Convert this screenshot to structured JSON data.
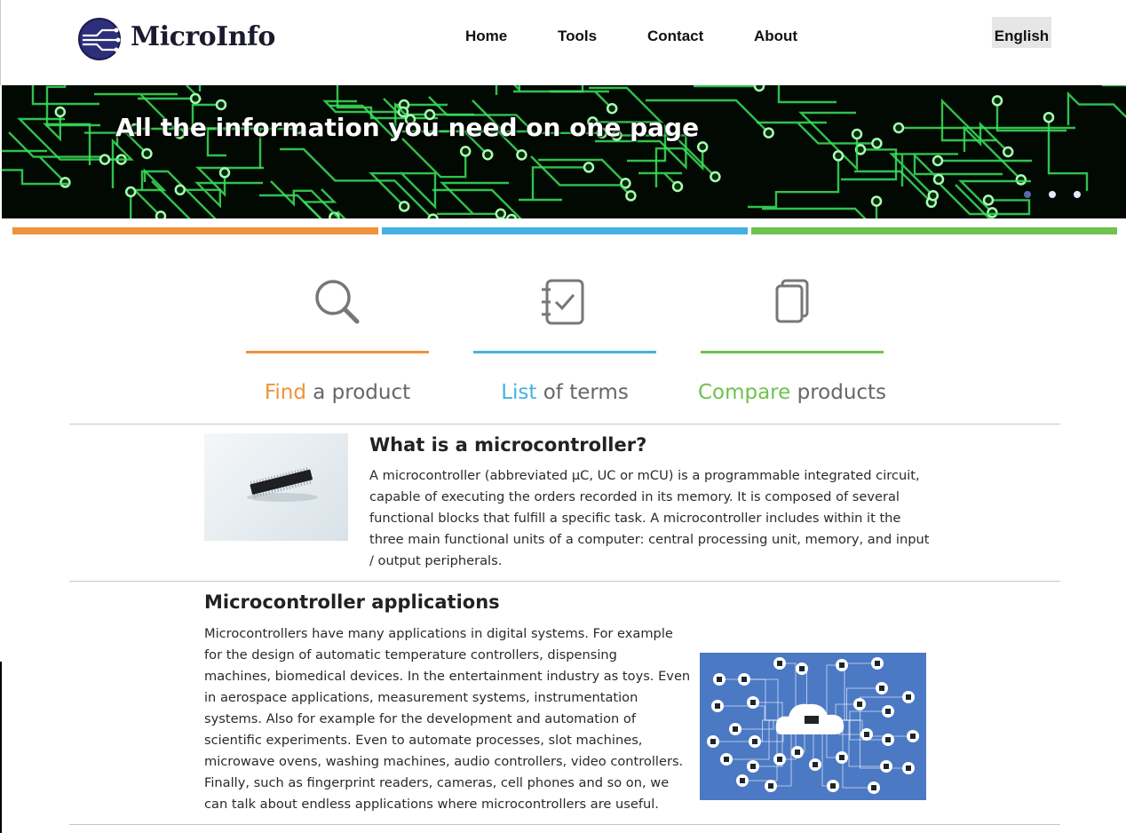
{
  "header": {
    "brand": "MicroInfo",
    "nav": [
      "Home",
      "Tools",
      "Contact",
      "About"
    ],
    "language": "English"
  },
  "hero": {
    "title": "All the information you need on one page",
    "carousel_dots": 3,
    "active_dot": 0
  },
  "colors": {
    "orange": "#f0923b",
    "blue": "#45b1e2",
    "green": "#6ec24e",
    "circuit": "#39e15a"
  },
  "features": [
    {
      "accent": "Find",
      "rest": " a product",
      "icon": "search-icon"
    },
    {
      "accent": "List",
      "rest": " of terms",
      "icon": "checklist-icon"
    },
    {
      "accent": "Compare",
      "rest": " products",
      "icon": "copy-icon"
    }
  ],
  "article1": {
    "title": "What is a microcontroller?",
    "lines": [
      "A microcontroller (abbreviated µC, UC or mCU) is a programmable integrated circuit,",
      "capable of executing the orders recorded in its memory. It is composed of several",
      "functional blocks that fulfill a specific task. A microcontroller includes within it the",
      "three main functional units of a computer: central processing unit, memory, and input",
      "/ output peripherals."
    ]
  },
  "article2": {
    "title": "Microcontroller applications",
    "lines": [
      "Microcontrollers have many applications in digital systems. For example",
      "for the design of automatic temperature controllers, dispensing",
      "machines, biomedical devices. In the entertainment industry as toys. Even",
      "in aerospace applications, measurement systems, instrumentation",
      "systems. Also for example for the development and automation of",
      "scientific experiments. Even to automate processes, slot machines,",
      "microwave ovens, washing machines, audio controllers, video controllers.",
      "Finally, such as fingerprint readers, cameras, cell phones and so on, we",
      "can talk about endless applications where microcontrollers are useful."
    ]
  }
}
